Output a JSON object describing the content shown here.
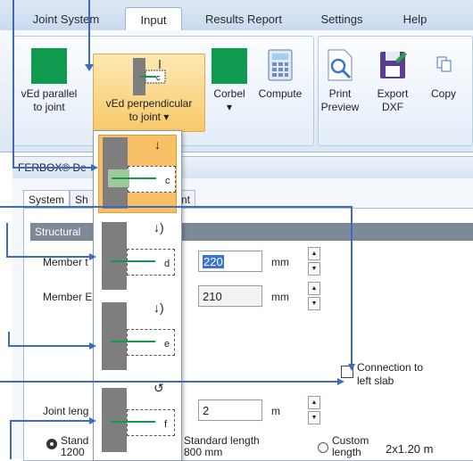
{
  "ribbon": {
    "tabs": [
      "Joint System",
      "Input",
      "Results Report",
      "Settings",
      "Help"
    ],
    "active_tab": "Input",
    "buttons": {
      "ved_parallel": [
        "vEd parallel",
        "to joint"
      ],
      "ved_perpendicular": [
        "vEd perpendicular",
        "to joint"
      ],
      "corbel": "Corbel",
      "compute": "Compute",
      "print_preview": [
        "Print",
        "Preview"
      ],
      "export_dxf": [
        "Export",
        "DXF"
      ],
      "copy": "Copy"
    }
  },
  "window": {
    "title": "FERBOX® De"
  },
  "subtabs": {
    "system": "System",
    "sh": "Sh",
    "nt": "nt"
  },
  "section": {
    "header": "Structural"
  },
  "fields": {
    "member_a_label": "Member t",
    "member_a_value": "220",
    "member_a_unit": "mm",
    "member_b_label": "Member E",
    "member_b_value": "210",
    "member_b_unit": "mm",
    "connection_label": [
      "Connection to",
      "left slab"
    ],
    "joint_length_label": "Joint leng",
    "joint_length_value": "2",
    "joint_length_unit": "m"
  },
  "radios": {
    "standard_a": [
      "Stand",
      "1200"
    ],
    "standard_b": [
      "Standard length",
      "800 mm"
    ],
    "custom": [
      "Custom",
      "length"
    ],
    "result": "2x1.20 m"
  },
  "gallery": {
    "items": [
      "c",
      "d",
      "e",
      "f"
    ],
    "selected": "c"
  },
  "colors": {
    "accent_arrow": "#3c6bc2",
    "highlight": "#f7c064",
    "green": "#0f9a4f"
  }
}
